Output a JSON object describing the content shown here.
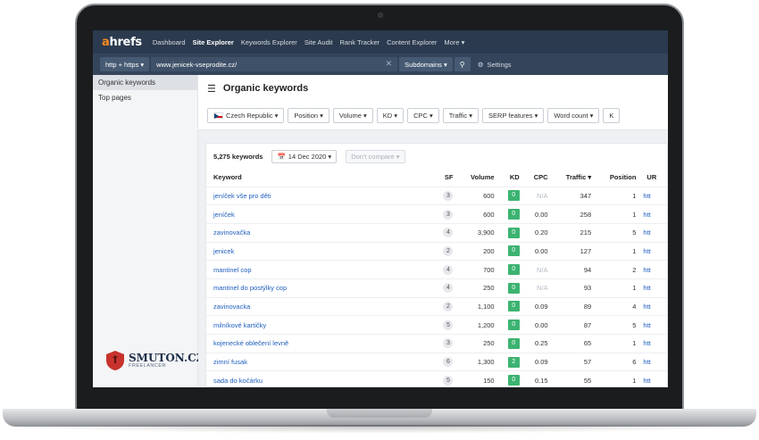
{
  "nav": {
    "logo_prefix": "a",
    "logo_rest": "hrefs",
    "items": [
      "Dashboard",
      "Site Explorer",
      "Keywords Explorer",
      "Site Audit",
      "Rank Tracker",
      "Content Explorer",
      "More ▾"
    ]
  },
  "urlbar": {
    "protocol": "http + https ▾",
    "url": "www.jenicek-vseprodite.cz/",
    "mode": "Subdomains ▾",
    "settings": "Settings"
  },
  "sidebar": {
    "items": [
      "Organic keywords",
      "Top pages"
    ],
    "brand_name": "SMUTON.CZ",
    "brand_sub": "FREELANCER"
  },
  "main": {
    "title": "Organic keywords",
    "filters": [
      "Czech Republic ▾",
      "Position ▾",
      "Volume ▾",
      "KD ▾",
      "CPC ▾",
      "Traffic ▾",
      "SERP features ▾",
      "Word count ▾",
      "K"
    ],
    "keyword_count": "5,275 keywords",
    "date": "14 Dec 2020 ▾",
    "compare": "Don't compare ▾"
  },
  "table": {
    "headers": [
      "Keyword",
      "SF",
      "Volume",
      "KD",
      "CPC",
      "Traffic ▾",
      "Position",
      "UR"
    ],
    "rows": [
      {
        "keyword": "jeníček vše pro děti",
        "sf": "3",
        "volume": "600",
        "kd": "0",
        "cpc": "N/A",
        "traffic": "347",
        "position": "1",
        "url": "htt"
      },
      {
        "keyword": "jeníček",
        "sf": "3",
        "volume": "600",
        "kd": "0",
        "cpc": "0.00",
        "traffic": "258",
        "position": "1",
        "url": "htt"
      },
      {
        "keyword": "zavinovačka",
        "sf": "4",
        "volume": "3,900",
        "kd": "0",
        "cpc": "0.20",
        "traffic": "215",
        "position": "5",
        "url": "htt"
      },
      {
        "keyword": "jenicek",
        "sf": "2",
        "volume": "200",
        "kd": "0",
        "cpc": "0.00",
        "traffic": "127",
        "position": "1",
        "url": "htt"
      },
      {
        "keyword": "mantinel cop",
        "sf": "4",
        "volume": "700",
        "kd": "0",
        "cpc": "N/A",
        "traffic": "94",
        "position": "2",
        "url": "htt"
      },
      {
        "keyword": "mantinel do postýlky cop",
        "sf": "4",
        "volume": "250",
        "kd": "0",
        "cpc": "N/A",
        "traffic": "93",
        "position": "1",
        "url": "htt"
      },
      {
        "keyword": "zavinovacka",
        "sf": "2",
        "volume": "1,100",
        "kd": "0",
        "cpc": "0.09",
        "traffic": "89",
        "position": "4",
        "url": "htt"
      },
      {
        "keyword": "milníkové kartičky",
        "sf": "5",
        "volume": "1,200",
        "kd": "0",
        "cpc": "0.00",
        "traffic": "87",
        "position": "5",
        "url": "htt"
      },
      {
        "keyword": "kojenecké oblečení levně",
        "sf": "3",
        "volume": "250",
        "kd": "0",
        "cpc": "0.25",
        "traffic": "65",
        "position": "1",
        "url": "htt"
      },
      {
        "keyword": "zimní fusak",
        "sf": "6",
        "volume": "1,300",
        "kd": "2",
        "cpc": "0.09",
        "traffic": "57",
        "position": "6",
        "url": "htt"
      },
      {
        "keyword": "sada do kočárku",
        "sf": "5",
        "volume": "150",
        "kd": "0",
        "cpc": "0.15",
        "traffic": "55",
        "position": "1",
        "url": "htt"
      }
    ]
  },
  "colors": {
    "nav_bg": "#2b3a4e",
    "logo_accent": "#ff8a1f",
    "kd_green": "#3cb371",
    "link_blue": "#1f5fbf"
  }
}
